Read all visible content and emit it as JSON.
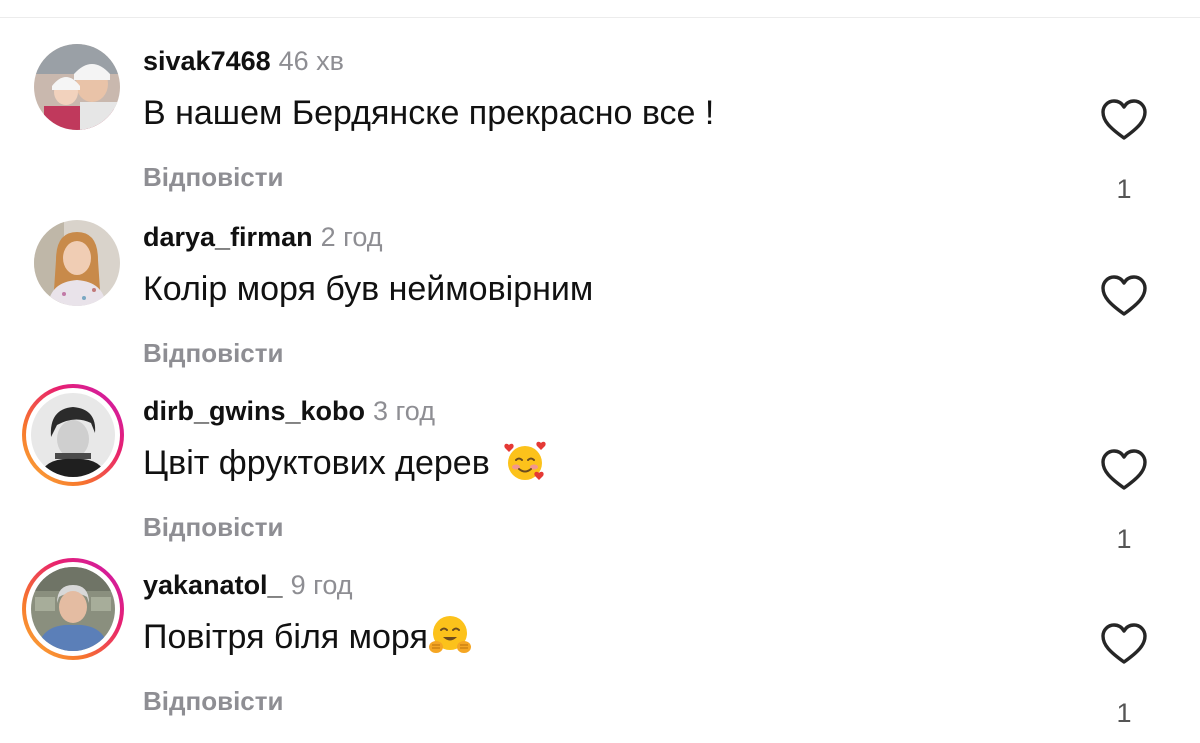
{
  "comments": [
    {
      "username": "sivak7468",
      "time": "46 хв",
      "text": "В нашем Бердянске прекрасно все !",
      "emoji": "",
      "reply_label": "Відповісти",
      "likes": "1",
      "avatar_ring": false
    },
    {
      "username": "darya_firman",
      "time": "2 год",
      "text": "Колір моря був неймовірним",
      "emoji": "",
      "reply_label": "Відповісти",
      "likes": "",
      "avatar_ring": false
    },
    {
      "username": "dirb_gwins_kobo",
      "time": "3 год",
      "text": "Цвіт фруктових дерев",
      "emoji": "smiling-face-with-hearts",
      "reply_label": "Відповісти",
      "likes": "1",
      "avatar_ring": true
    },
    {
      "username": "yakanatol_",
      "time": "9 год",
      "text": "Повітря біля моря",
      "emoji": "hugging-face",
      "reply_label": "Відповісти",
      "likes": "1",
      "avatar_ring": true
    }
  ],
  "icons": {
    "like": "heart-outline-icon"
  },
  "colors": {
    "muted": "#8e8e93",
    "story_ring_start": "#fbb33c",
    "story_ring_end": "#c71ab8"
  }
}
